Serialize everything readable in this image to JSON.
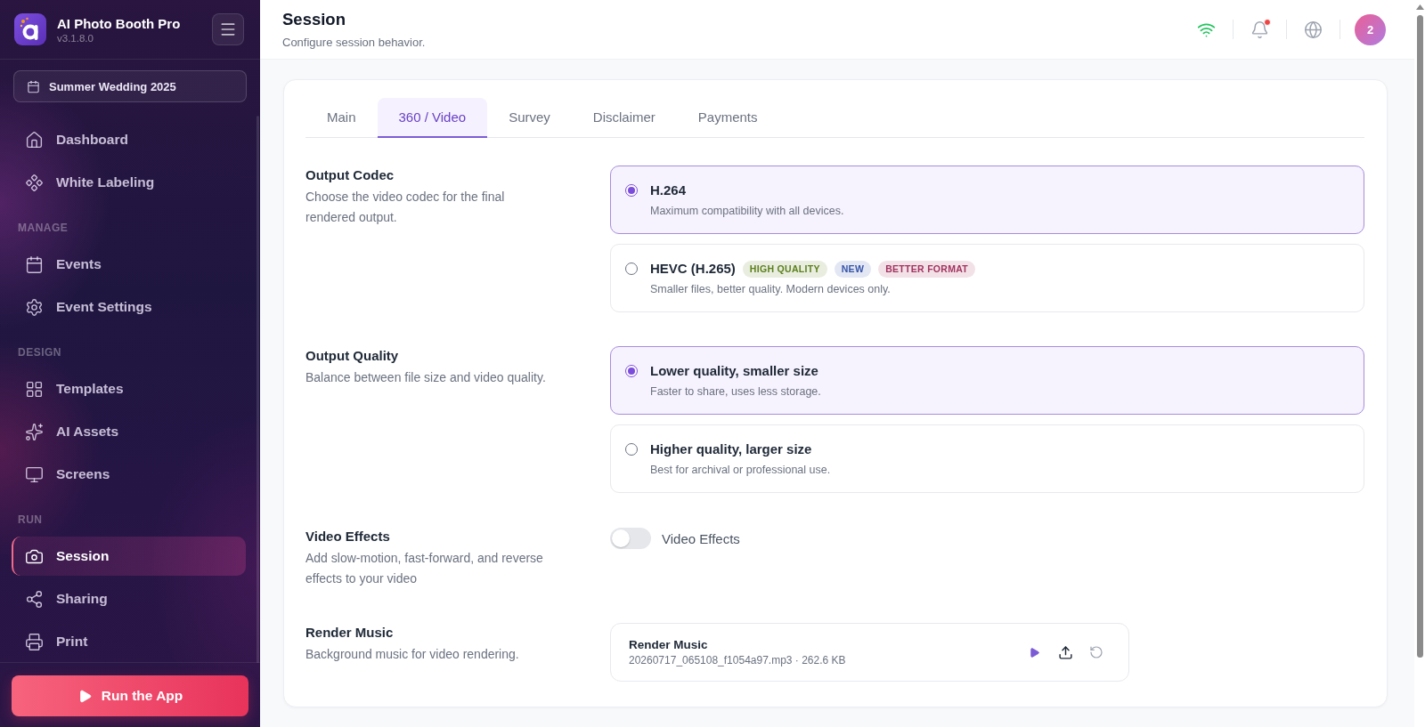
{
  "sidebar": {
    "app_name": "AI Photo Booth Pro",
    "version": "v3.1.8.0",
    "event": "Summer Wedding 2025",
    "sections": [
      {
        "items": [
          {
            "label": "Dashboard",
            "selected": false
          },
          {
            "label": "White Labeling",
            "selected": false
          }
        ]
      },
      {
        "heading": "MANAGE",
        "items": [
          {
            "label": "Events",
            "selected": false
          },
          {
            "label": "Event Settings",
            "selected": false
          }
        ]
      },
      {
        "heading": "DESIGN",
        "items": [
          {
            "label": "Templates",
            "selected": false
          },
          {
            "label": "AI Assets",
            "selected": false
          },
          {
            "label": "Screens",
            "selected": false
          }
        ]
      },
      {
        "heading": "RUN",
        "items": [
          {
            "label": "Session",
            "selected": true
          },
          {
            "label": "Sharing",
            "selected": false
          },
          {
            "label": "Print",
            "selected": false
          }
        ]
      }
    ],
    "run_button": "Run the App"
  },
  "header": {
    "title": "Session",
    "subtitle": "Configure session behavior.",
    "notifications": {
      "unread": true
    },
    "avatar": "2"
  },
  "tabs": [
    {
      "label": "Main",
      "selected": false
    },
    {
      "label": "360 / Video",
      "selected": true
    },
    {
      "label": "Survey",
      "selected": false
    },
    {
      "label": "Disclaimer",
      "selected": false
    },
    {
      "label": "Payments",
      "selected": false
    }
  ],
  "settings": [
    {
      "kind": "radio",
      "title": "Output Codec",
      "description": "Choose the video codec for the final rendered output.",
      "options": [
        {
          "label": "H.264",
          "description": "Maximum compatibility with all devices.",
          "selected": true
        },
        {
          "label": "HEVC (H.265)",
          "description": "Smaller files, better quality. Modern devices only.",
          "selected": false,
          "badges": [
            {
              "text": "HIGH QUALITY",
              "color": "#5b7f1b"
            },
            {
              "text": "NEW",
              "color": "#3553a8"
            },
            {
              "text": "BETTER FORMAT",
              "color": "#a3325e"
            }
          ]
        }
      ]
    },
    {
      "kind": "radio",
      "title": "Output Quality",
      "description": "Balance between file size and video quality.",
      "options": [
        {
          "label": "Lower quality, smaller size",
          "description": "Faster to share, uses less storage.",
          "selected": true
        },
        {
          "label": "Higher quality, larger size",
          "description": "Best for archival or professional use.",
          "selected": false
        }
      ]
    },
    {
      "kind": "toggle",
      "title": "Video Effects",
      "description": "Add slow-motion, fast-forward, and reverse effects to your video",
      "toggle": {
        "label": "Video Effects",
        "on": false
      }
    },
    {
      "kind": "file",
      "title": "Render Music",
      "description": "Background music for video rendering.",
      "file": {
        "name": "Render Music",
        "details": "20260717_065108_f1054a97.mp3 · 262.6 KB"
      }
    }
  ]
}
